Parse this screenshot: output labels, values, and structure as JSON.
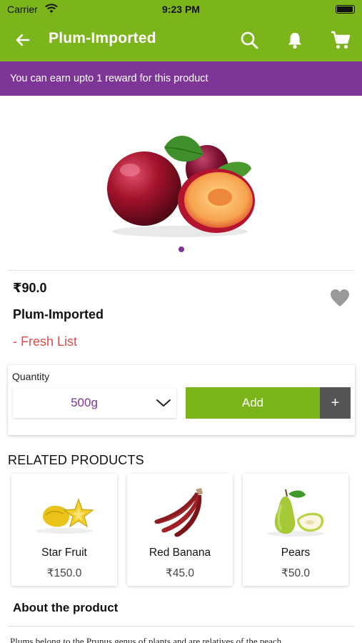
{
  "status_bar": {
    "carrier": "Carrier",
    "time": "9:23 PM"
  },
  "header": {
    "title": "Plum-Imported"
  },
  "reward_banner": {
    "text": "You can earn upto 1 reward for this product"
  },
  "product": {
    "price": "₹90.0",
    "name": "Plum-Imported",
    "list_tag": "- Fresh List"
  },
  "quantity": {
    "label": "Quantity",
    "selected": "500g",
    "add_label": "Add",
    "plus_label": "+"
  },
  "related": {
    "title": "RELATED PRODUCTS",
    "items": [
      {
        "name": "Star Fruit",
        "price": "₹150.0"
      },
      {
        "name": "Red Banana",
        "price": "₹45.0"
      },
      {
        "name": "Pears",
        "price": "₹50.0"
      }
    ]
  },
  "about": {
    "title": "About the product",
    "text": "Plums belong to the Prunus genus of plants and are relatives of the peach"
  },
  "colors": {
    "brand_green": "#7cb41b",
    "brand_purple": "#7d3597",
    "tag_red": "#e24c4c"
  },
  "icons": [
    "back-arrow-icon",
    "search-icon",
    "bell-icon",
    "cart-icon",
    "heart-icon",
    "chevron-down-icon",
    "wifi-icon",
    "battery-icon"
  ]
}
